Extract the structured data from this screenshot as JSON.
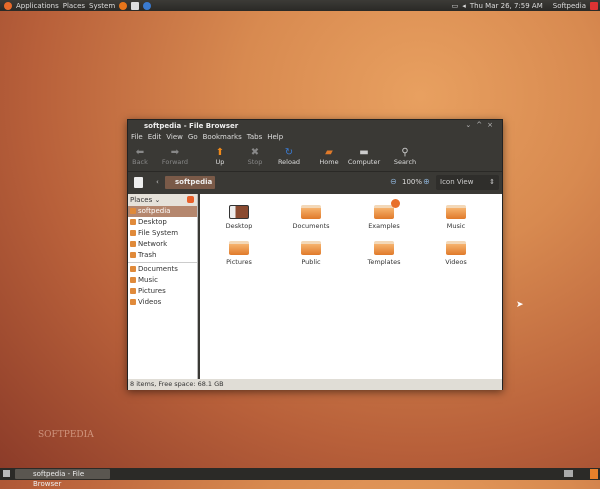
{
  "top_panel": {
    "menus": [
      "Applications",
      "Places",
      "System"
    ],
    "clock": "Thu Mar 26,  7:59 AM",
    "user": "Softpedia"
  },
  "window": {
    "title": "softpedia - File Browser",
    "menu": [
      "File",
      "Edit",
      "View",
      "Go",
      "Bookmarks",
      "Tabs",
      "Help"
    ],
    "toolbar": {
      "back": "Back",
      "forward": "Forward",
      "up": "Up",
      "stop": "Stop",
      "reload": "Reload",
      "home": "Home",
      "computer": "Computer",
      "search": "Search"
    },
    "location": {
      "crumb": "softpedia",
      "zoom": "100%",
      "view": "Icon View"
    },
    "sidebar": {
      "header": "Places",
      "items": [
        "softpedia",
        "Desktop",
        "File System",
        "Network",
        "Trash"
      ],
      "bookmarks": [
        "Documents",
        "Music",
        "Pictures",
        "Videos"
      ]
    },
    "files": [
      "Desktop",
      "Documents",
      "Examples",
      "Music",
      "Pictures",
      "Public",
      "Templates",
      "Videos"
    ],
    "status": "8 items, Free space: 68.1 GB"
  },
  "taskbar": {
    "task": "softpedia - File Browser"
  },
  "watermark": "SOFTPEDIA"
}
